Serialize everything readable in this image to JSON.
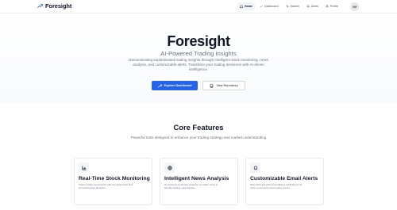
{
  "brand": {
    "name": "Foresight",
    "logo_icon": "trending-up-icon"
  },
  "nav": {
    "items": [
      {
        "label": "Home",
        "icon": "home-icon",
        "active": true
      },
      {
        "label": "Dashboard",
        "icon": "chart-icon",
        "active": false
      },
      {
        "label": "Market",
        "icon": "activity-icon",
        "active": false
      },
      {
        "label": "Alerts",
        "icon": "bell-icon",
        "active": false
      },
      {
        "label": "Profile",
        "icon": "user-icon",
        "active": false
      }
    ],
    "avatar_initials": "VM"
  },
  "hero": {
    "title": "Foresight",
    "subtitle": "AI-Powered Trading Insights",
    "description": "Demonstrating sophisticated trading insights through intelligent stock monitoring, news analysis, and customizable alerts. Transform your trading decisions with AI-driven intelligence.",
    "primary_button": "Explore Dashboard",
    "secondary_button": "View Repository"
  },
  "features": {
    "title": "Core Features",
    "description": "Powerful tools designed to enhance your trading strategy and market understanding",
    "cards": [
      {
        "title": "Real-Time Stock Monitoring",
        "description": "Track market movements with live data feeds and comprehensive analytics",
        "icon": "bar-chart-icon"
      },
      {
        "title": "Intelligent News Analysis",
        "description": "AI-powered sentiment analysis of market news to identify trading opportunities",
        "icon": "globe-icon"
      },
      {
        "title": "Customizable Email Alerts",
        "description": "Stay informed with personalized notifications for price movements and market events",
        "icon": "bell-icon"
      }
    ]
  },
  "colors": {
    "accent": "#2563eb",
    "text": "#111827",
    "muted": "#6b7280"
  }
}
